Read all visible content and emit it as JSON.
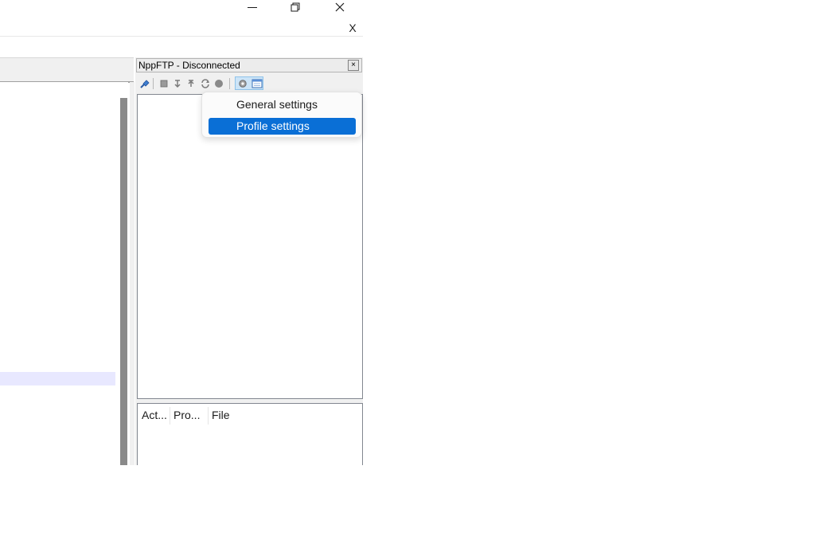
{
  "window": {
    "minimize_icon": "minimize-icon",
    "restore_icon": "restore-icon",
    "close_icon": "close-icon",
    "tab_close_label": "X"
  },
  "panel": {
    "title": "NppFTP - Disconnected",
    "close_label": "×",
    "toolbar": {
      "icons": [
        "connect-icon",
        "disconnect-icon",
        "download-icon",
        "upload-icon",
        "refresh-icon",
        "abort-icon",
        "settings-icon",
        "message-window-icon"
      ]
    },
    "queue_columns": [
      "Act...",
      "Pro...",
      "File"
    ]
  },
  "menu": {
    "items": [
      {
        "label": "General settings",
        "selected": false
      },
      {
        "label": "Profile settings",
        "selected": true
      }
    ]
  },
  "colors": {
    "accent": "#0a6fd6",
    "current_line": "#e8e8ff"
  }
}
